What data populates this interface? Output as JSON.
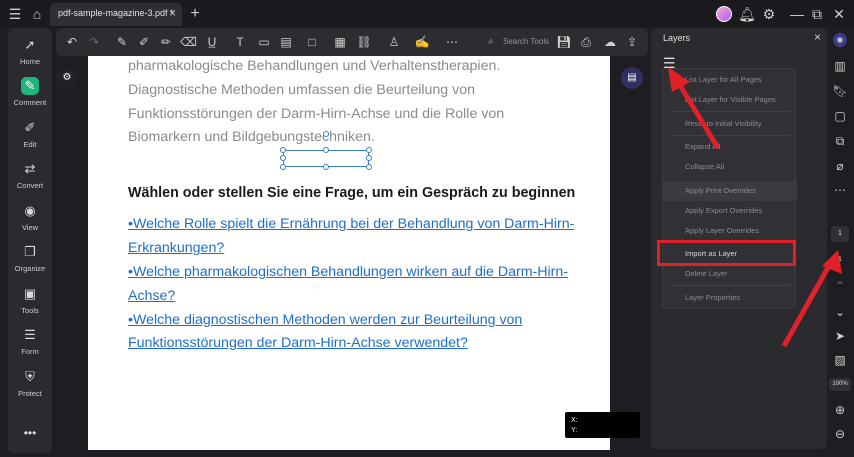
{
  "titlebar": {
    "tab_title": "pdf-sample-magazine-3.pdf *",
    "tab_close": "×",
    "new_tab": "+",
    "window_controls": [
      "—",
      "⧉",
      "✕"
    ]
  },
  "sidebar": {
    "items": [
      {
        "label": "Home",
        "icon": "rocket-icon",
        "glyph": "➚"
      },
      {
        "label": "Comment",
        "icon": "comment-icon",
        "glyph": "✎"
      },
      {
        "label": "Edit",
        "icon": "edit-icon",
        "glyph": "✐"
      },
      {
        "label": "Convert",
        "icon": "convert-icon",
        "glyph": "⇄"
      },
      {
        "label": "View",
        "icon": "eye-icon",
        "glyph": "◉"
      },
      {
        "label": "Organize",
        "icon": "organize-icon",
        "glyph": "❐"
      },
      {
        "label": "Tools",
        "icon": "toolbox-icon",
        "glyph": "▣"
      },
      {
        "label": "Form",
        "icon": "form-icon",
        "glyph": "☰"
      },
      {
        "label": "Protect",
        "icon": "shield-icon",
        "glyph": "⛨"
      }
    ],
    "more": "•••"
  },
  "toolbar": {
    "search_placeholder": "Search Tools"
  },
  "document": {
    "paragraph_lines": [
      "pharmakologische Behandlungen und Verhaltenstherapien.",
      "Diagnostische Methoden umfassen die Beurteilung von",
      "Funktionsstörungen der Darm-Hirn-Achse und die Rolle von",
      "Biomarkern und Bildgebungstechniken."
    ],
    "heading": "Wählen oder stellen Sie eine Frage, um ein Gespräch zu beginnen",
    "question_lines": [
      "•Welche Rolle spielt die Ernährung bei der Behandlung von Darm-Hirn-",
      "Erkrankungen?",
      "•Welche pharmakologischen Behandlungen wirken auf die Darm-Hirn-",
      "Achse?",
      "•Welche diagnostischen Methoden werden zur Beurteilung von",
      "Funktionsstörungen der Darm-Hirn-Achse verwendet?"
    ],
    "coords": {
      "x_label": "X:",
      "y_label": "Y:"
    }
  },
  "layers": {
    "title": "Layers",
    "close": "×",
    "menu_items": [
      "List Layer for All Pages",
      "List Layer for Visible Pages",
      "Reset to Initial Visibility",
      "Expand All",
      "Collapse All",
      "Apply Print Overrides",
      "Apply Export Overrides",
      "Apply Layer Overrides",
      "Import as Layer",
      "Delete Layer",
      "Layer Properties"
    ]
  },
  "rightbar": {
    "page_current": "1",
    "page_total": "1",
    "zoom": "100%"
  },
  "colors": {
    "accent_green": "#1fb57a",
    "link_blue": "#1f6ec9",
    "annotation_red": "#e2202a"
  }
}
